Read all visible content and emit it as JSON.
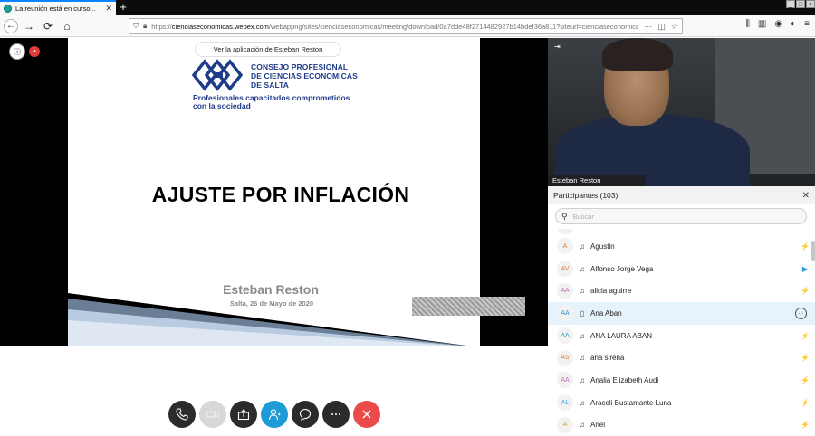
{
  "browser": {
    "tab_title": "La reunión está en curso...",
    "url_host": "cienciaseconomicas.webex.com",
    "url_prefix": "https://",
    "url_rest": "/webappng/sites/cienciaseconomicas/meeting/download/0a7dde48f2714482927b14bdef36a811?siteurl=cienciaseconomicas&...",
    "window_controls": [
      "_",
      "□",
      "×"
    ]
  },
  "stage": {
    "app_banner": "Ver la aplicación de Esteban Reston",
    "logo_lines": [
      "CONSEJO PROFESIONAL",
      "DE CIENCIAS ECONOMICAS",
      "DE SALTA"
    ],
    "logo_tagline": [
      "Profesionales capacitados comprometidos",
      "con la sociedad"
    ],
    "slide_title": "AJUSTE POR INFLACIÓN",
    "slide_author": "Esteban Reston",
    "slide_date": "Salta, 26 de Mayo de 2020",
    "logo_color": "#1f3c8a"
  },
  "video": {
    "name": "Esteban Reston"
  },
  "participants": {
    "title": "Participantes (103)",
    "search_placeholder": "Buscar",
    "list": [
      {
        "initials": "A",
        "initials_color": "#e07a3a",
        "device": "headset-icon",
        "name": "Agustin",
        "status": "mute"
      },
      {
        "initials": "AV",
        "initials_color": "#e07a3a",
        "device": "headset-icon",
        "name": "Alfonso Jorge Vega",
        "status": "video"
      },
      {
        "initials": "AA",
        "initials_color": "#c36fb8",
        "device": "headset-icon",
        "name": "alicia aguirre",
        "status": "mute"
      },
      {
        "initials": "AA",
        "initials_color": "#2a9ad6",
        "device": "phone-icon",
        "name": "Ana Aban",
        "status": "chat"
      },
      {
        "initials": "AA",
        "initials_color": "#2a9ad6",
        "device": "headset-icon",
        "name": "ANA LAURA ABAN",
        "status": "mute"
      },
      {
        "initials": "AS",
        "initials_color": "#e07a3a",
        "device": "headset-icon",
        "name": "ana sirena",
        "status": "mute"
      },
      {
        "initials": "AA",
        "initials_color": "#c36fb8",
        "device": "headset-icon",
        "name": "Analia Elizabeth Audi",
        "status": "mute"
      },
      {
        "initials": "AL",
        "initials_color": "#2a9ad6",
        "device": "headset-icon",
        "name": "Araceli Bustamante Luna",
        "status": "mute"
      },
      {
        "initials": "A",
        "initials_color": "#e0a020",
        "device": "headset-icon",
        "name": "Ariel",
        "status": "mute"
      }
    ]
  },
  "controls": [
    {
      "name": "audio-button",
      "icon": "phone-icon"
    },
    {
      "name": "video-button",
      "icon": "camera-icon"
    },
    {
      "name": "share-button",
      "icon": "share-icon"
    },
    {
      "name": "participants-button",
      "icon": "participants-icon"
    },
    {
      "name": "chat-button",
      "icon": "chat-icon"
    },
    {
      "name": "more-button",
      "icon": "more-icon"
    },
    {
      "name": "leave-button",
      "icon": "close-icon"
    }
  ]
}
